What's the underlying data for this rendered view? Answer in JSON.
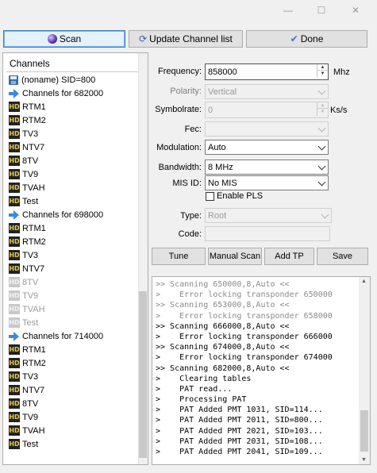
{
  "toolbar": {
    "scan_label": "Scan",
    "update_label": "Update Channel list",
    "done_label": "Done"
  },
  "tree": {
    "header": "Channels",
    "items": [
      {
        "kind": "floppy",
        "label": "(noname) SID=800",
        "dim": false
      },
      {
        "kind": "arrow",
        "label": "Channels for 682000",
        "dim": false
      },
      {
        "kind": "hd",
        "label": "RTM1",
        "dim": false
      },
      {
        "kind": "hd",
        "label": "RTM2",
        "dim": false
      },
      {
        "kind": "hd",
        "label": "TV3",
        "dim": false
      },
      {
        "kind": "hd",
        "label": "NTV7",
        "dim": false
      },
      {
        "kind": "hd",
        "label": "8TV",
        "dim": false
      },
      {
        "kind": "hd",
        "label": "TV9",
        "dim": false
      },
      {
        "kind": "hd",
        "label": "TVAH",
        "dim": false
      },
      {
        "kind": "hd",
        "label": "Test",
        "dim": false
      },
      {
        "kind": "arrow",
        "label": "Channels for 698000",
        "dim": false
      },
      {
        "kind": "hd",
        "label": "RTM1",
        "dim": false
      },
      {
        "kind": "hd",
        "label": "RTM2",
        "dim": false
      },
      {
        "kind": "hd",
        "label": "TV3",
        "dim": false
      },
      {
        "kind": "hd",
        "label": "NTV7",
        "dim": false
      },
      {
        "kind": "hd",
        "label": "8TV",
        "dim": true
      },
      {
        "kind": "hd",
        "label": "TV9",
        "dim": true
      },
      {
        "kind": "hd",
        "label": "TVAH",
        "dim": true
      },
      {
        "kind": "hd",
        "label": "Test",
        "dim": true
      },
      {
        "kind": "arrow",
        "label": "Channels for 714000",
        "dim": false
      },
      {
        "kind": "hd",
        "label": "RTM1",
        "dim": false
      },
      {
        "kind": "hd",
        "label": "RTM2",
        "dim": false
      },
      {
        "kind": "hd",
        "label": "TV3",
        "dim": false
      },
      {
        "kind": "hd",
        "label": "NTV7",
        "dim": false
      },
      {
        "kind": "hd",
        "label": "8TV",
        "dim": false
      },
      {
        "kind": "hd",
        "label": "TV9",
        "dim": false
      },
      {
        "kind": "hd",
        "label": "TVAH",
        "dim": false
      },
      {
        "kind": "hd",
        "label": "Test",
        "dim": false
      }
    ]
  },
  "form": {
    "frequency_label": "Frequency:",
    "frequency_value": "858000",
    "frequency_unit": "Mhz",
    "polarity_label": "Polarity:",
    "polarity_value": "Vertical",
    "symbolrate_label": "Symbolrate:",
    "symbolrate_value": "0",
    "symbolrate_unit": "Ks/s",
    "fec_label": "Fec:",
    "fec_value": "",
    "modulation_label": "Modulation:",
    "modulation_value": "Auto",
    "bandwidth_label": "Bandwidth:",
    "bandwidth_value": "8 MHz",
    "misid_label": "MIS ID:",
    "misid_value": "No MIS",
    "enable_pls_label": "Enable PLS",
    "type_label": "Type:",
    "type_value": "Root",
    "code_label": "Code:",
    "code_value": ""
  },
  "actions": {
    "tune": "Tune",
    "manual_scan": "Manual Scan",
    "add_tp": "Add TP",
    "save": "Save"
  },
  "log": [
    {
      "text": ">> Scanning 650000,8,Auto <<",
      "grey": true
    },
    {
      "text": ">    Error locking transponder 650000",
      "grey": true
    },
    {
      "text": ">> Scanning 653000,8,Auto <<",
      "grey": true
    },
    {
      "text": ">    Error locking transponder 658000",
      "grey": true
    },
    {
      "text": ">> Scanning 666000,8,Auto <<",
      "grey": false
    },
    {
      "text": ">    Error locking transponder 666000",
      "grey": false
    },
    {
      "text": ">> Scanning 674000,8,Auto <<",
      "grey": false
    },
    {
      "text": ">    Error locking transponder 674000",
      "grey": false
    },
    {
      "text": ">> Scanning 682000,8,Auto <<",
      "grey": false
    },
    {
      "text": ">    Clearing tables",
      "grey": false
    },
    {
      "text": ">    PAT read...",
      "grey": false
    },
    {
      "text": ">    Processing PAT",
      "grey": false
    },
    {
      "text": ">    PAT Added PMT 1031, SID=114...",
      "grey": false
    },
    {
      "text": ">    PAT Added PMT 2011, SID=800...",
      "grey": false
    },
    {
      "text": ">    PAT Added PMT 2021, SID=103...",
      "grey": false
    },
    {
      "text": ">    PAT Added PMT 2031, SID=108...",
      "grey": false
    },
    {
      "text": ">    PAT Added PMT 2041, SID=109...",
      "grey": false
    }
  ]
}
